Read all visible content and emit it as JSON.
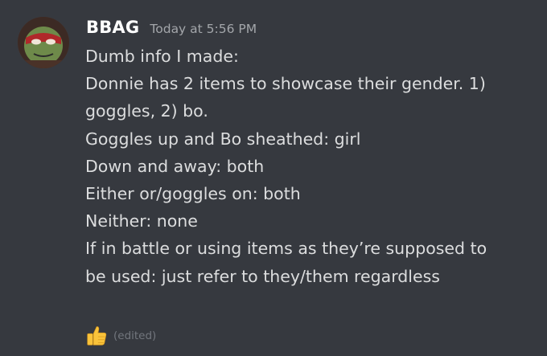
{
  "message": {
    "author": "BBAG",
    "timestamp": "Today at 5:56 PM",
    "lines": [
      "Dumb info I made:",
      "Donnie has 2 items to showcase their gender. 1)",
      "goggles, 2) bo.",
      "Goggles up and Bo sheathed: girl",
      "Down and away: both",
      "Either or/goggles on: both",
      "Neither: none",
      "If in battle or using items as they’re supposed to",
      "be used: just refer to they/them regardless"
    ],
    "reaction_icon": "thumbs-up-icon",
    "edited_label": "(edited)"
  },
  "colors": {
    "background": "#36393f",
    "username": "#ffffff",
    "text": "#dcddde",
    "timestamp": "#a3a6aa",
    "edited": "#72767d"
  }
}
